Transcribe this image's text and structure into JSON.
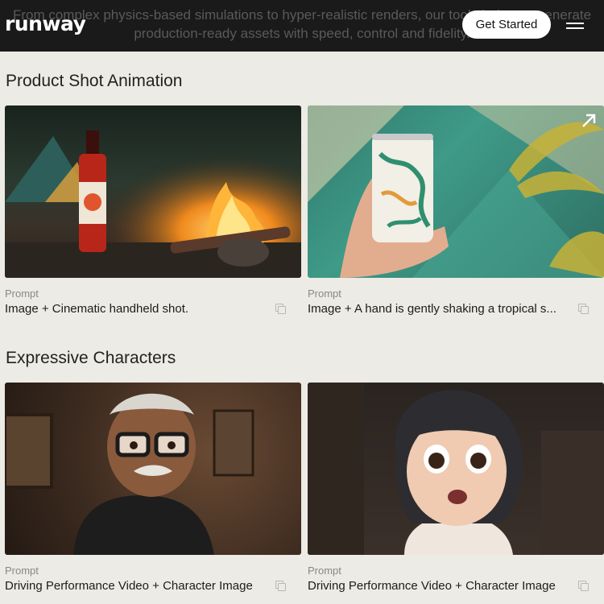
{
  "header": {
    "behind_line1": "From complex physics-based simulations to hyper-realistic renders, our tools help you generate",
    "behind_line2": "production-ready assets with speed, control and fidelity.",
    "logo": "runway",
    "cta": "Get Started"
  },
  "sections": [
    {
      "title": "Product Shot Animation",
      "cards": [
        {
          "label": "Prompt",
          "text": "Image + Cinematic handheld shot."
        },
        {
          "label": "Prompt",
          "text": "Image + A hand is gently shaking a tropical s..."
        }
      ]
    },
    {
      "title": "Expressive Characters",
      "cards": [
        {
          "label": "Prompt",
          "text": "Driving Performance Video + Character Image"
        },
        {
          "label": "Prompt",
          "text": "Driving Performance Video + Character Image"
        }
      ]
    }
  ]
}
